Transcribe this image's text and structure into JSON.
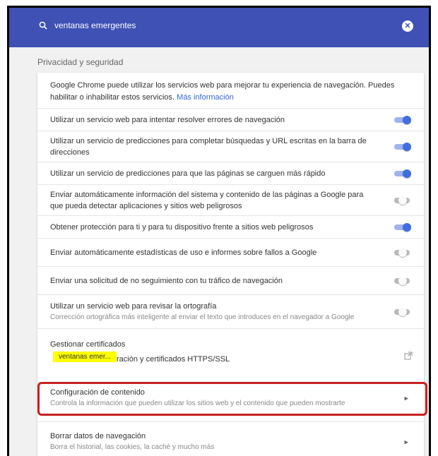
{
  "search": {
    "value": "ventanas emergentes",
    "clear_glyph": "✕"
  },
  "section_title": "Privacidad y seguridad",
  "intro": {
    "text": "Google Chrome puede utilizar los servicios web para mejorar tu experiencia de navegación. Puedes habilitar o inhabilitar estos servicios.",
    "link": "Más información"
  },
  "settings": [
    {
      "label": "Utilizar un servicio web para intentar resolver errores de navegación",
      "enabled": true
    },
    {
      "label": "Utilizar un servicio de predicciones para completar búsquedas y URL escritas en la barra de direcciones",
      "enabled": true
    },
    {
      "label": "Utilizar un servicio de predicciones para que las páginas se carguen más rápido",
      "enabled": true
    },
    {
      "label": "Enviar automáticamente información del sistema y contenido de las páginas a Google para que pueda detectar aplicaciones y sitios web peligrosos",
      "enabled": false
    },
    {
      "label": "Obtener protección para ti y para tu dispositivo frente a sitios web peligrosos",
      "enabled": true
    },
    {
      "label": "Enviar automáticamente estadísticas de uso e informes sobre fallos a Google",
      "enabled": false
    },
    {
      "label": "Enviar una solicitud de no seguimiento con tu tráfico de navegación",
      "enabled": false
    },
    {
      "label": "Utilizar un servicio web para revisar la ortografía",
      "sublabel": "Corrección ortográfica más inteligente al enviar el texto que introduces en el navegador a Google",
      "enabled": false
    }
  ],
  "certificates": {
    "label": "Gestionar certificados",
    "sublabel": "ración y certificados HTTPS/SSL",
    "highlight": "ventanas emer..."
  },
  "content_settings": {
    "label": "Configuración de contenido",
    "sublabel": "Controla la información que pueden utilizar los sitios web y el contenido que pueden mostrarte"
  },
  "clear_data": {
    "label": "Borrar datos de navegación",
    "sublabel": "Borra el historial, las cookies, la caché y mucho más"
  },
  "colors": {
    "header": "#3f51b5",
    "toggle_on": "#3f6ee0",
    "highlight_box": "#c62020"
  }
}
